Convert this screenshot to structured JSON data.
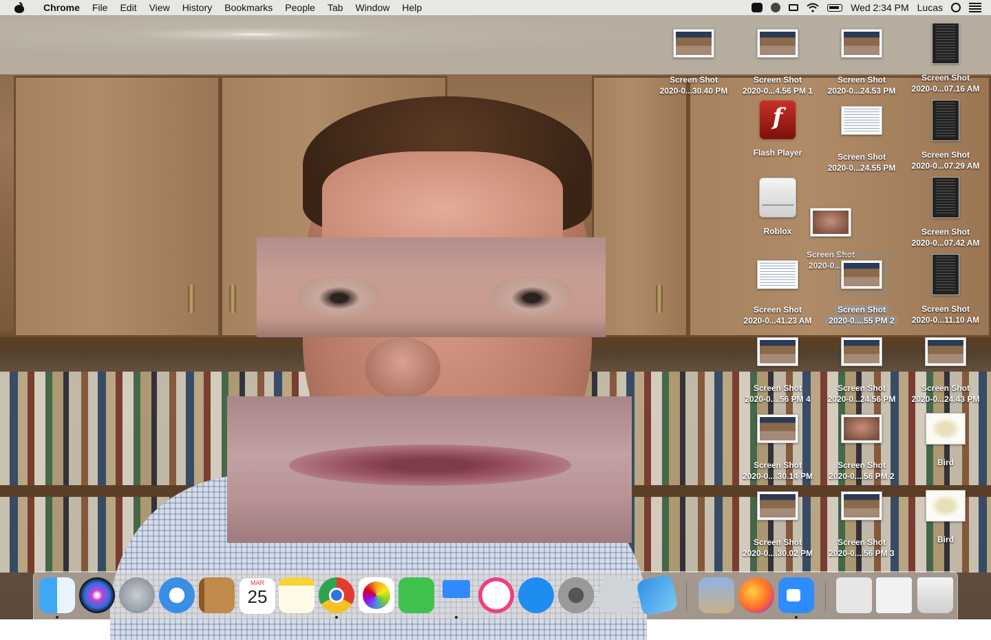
{
  "menubar": {
    "app_name": "Chrome",
    "menus": [
      "File",
      "Edit",
      "View",
      "History",
      "Bookmarks",
      "People",
      "Tab",
      "Window",
      "Help"
    ],
    "clock": "Wed 2:34 PM",
    "user": "Lucas",
    "status_icons": [
      "zoom-icon",
      "screen-record-icon",
      "airplay-icon",
      "wifi-icon",
      "battery-icon",
      "spotlight-icon",
      "notification-center-icon"
    ]
  },
  "desktop_icons": [
    {
      "name": "Screen Shot",
      "sub": "2020-0...30.40 PM"
    },
    {
      "name": "Screen Shot",
      "sub": "2020-0...4.56 PM 1"
    },
    {
      "name": "Screen Shot",
      "sub": "2020-0...24.53 PM"
    },
    {
      "name": "Screen Shot",
      "sub": "2020-0...07.16 AM"
    },
    {
      "name": "Flash Player",
      "sub": ""
    },
    {
      "name": "Screen Shot",
      "sub": "2020-0...24.55 PM"
    },
    {
      "name": "Screen Shot",
      "sub": "2020-0...07.29 AM"
    },
    {
      "name": "Roblox",
      "sub": ""
    },
    {
      "name": "Screen Shot",
      "sub": "2020-0...4.5"
    },
    {
      "name": "Screen Shot",
      "sub": "2020-0...07.42 AM"
    },
    {
      "name": "Screen Shot",
      "sub": "2020-0...41.23 AM"
    },
    {
      "name": "Screen Shot",
      "sub": "2020-0....55 PM 2"
    },
    {
      "name": "Screen Shot",
      "sub": "2020-0...11.10 AM"
    },
    {
      "name": "Screen Shot",
      "sub": "2020-0....56 PM 4"
    },
    {
      "name": "Screen Shot",
      "sub": "2020-0...24.56 PM"
    },
    {
      "name": "Screen Shot",
      "sub": "2020-0...24.43 PM"
    },
    {
      "name": "Screen Shot",
      "sub": "2020-0....30.14 PM"
    },
    {
      "name": "Screen Shot",
      "sub": "2020-0....56 PM 2"
    },
    {
      "name": "Bird",
      "sub": ""
    },
    {
      "name": "Screen Shot",
      "sub": "2020-0....30.02 PM"
    },
    {
      "name": "Screen Shot",
      "sub": "2020-0....56 PM 3"
    },
    {
      "name": "Bird",
      "sub": ""
    }
  ],
  "dock": {
    "calendar_month": "MAR",
    "calendar_day": "25",
    "apps": [
      "finder-icon",
      "siri-icon",
      "launchpad-icon",
      "safari-icon",
      "contacts-icon",
      "calendar-icon",
      "notes-icon",
      "chrome-icon",
      "photos-icon",
      "facetime-icon",
      "keynote-icon",
      "itunes-icon",
      "app-store-icon",
      "system-preferences-icon",
      "roblox-icon",
      "app-icon",
      "preview-icon",
      "firefox-icon",
      "zoom-icon",
      "downloads-folder-icon",
      "screenshots-folder-icon",
      "trash-icon"
    ]
  }
}
